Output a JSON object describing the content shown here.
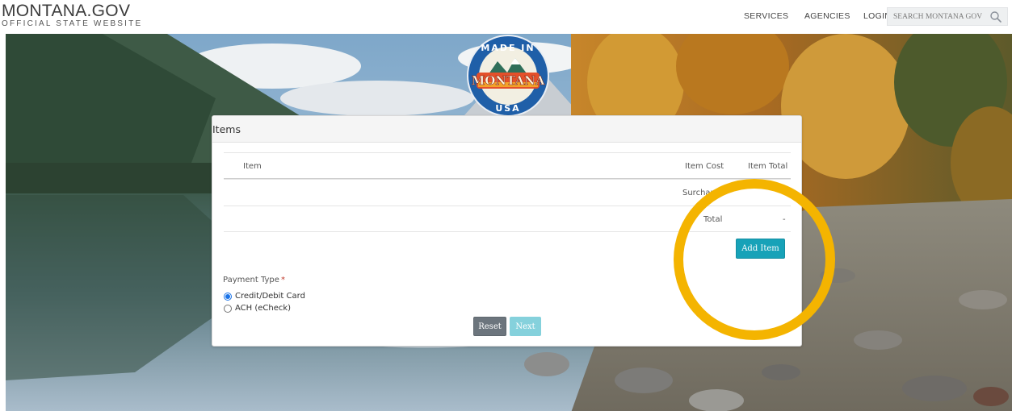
{
  "header": {
    "brand_name": "MONTANA.GOV",
    "brand_tagline": "OFFICIAL STATE WEBSITE",
    "nav": [
      "SERVICES",
      "AGENCIES",
      "LOGIN"
    ],
    "search_placeholder": "SEARCH MONTANA GOV",
    "search_icon": "magnifier-icon"
  },
  "logo": {
    "line1": "MADE IN",
    "line2": "MONTANA",
    "line3": "USA"
  },
  "card": {
    "title": "Items",
    "table": {
      "headers": [
        "Item",
        "Item Cost",
        "Item Total"
      ],
      "surcharge_label": "Surcharge",
      "surcharge_value": "-",
      "total_label": "Total",
      "total_value": "-"
    },
    "add_item_label": "Add Item",
    "payment_type_label": "Payment Type",
    "required_marker": "*",
    "payment_options": [
      {
        "label": "Credit/Debit Card",
        "selected": true
      },
      {
        "label": "ACH (eCheck)",
        "selected": false
      }
    ],
    "reset_label": "Reset",
    "next_label": "Next"
  },
  "colors": {
    "primary_teal": "#17a2b8",
    "secondary_gray": "#6c757d",
    "highlight": "#f4b400"
  }
}
